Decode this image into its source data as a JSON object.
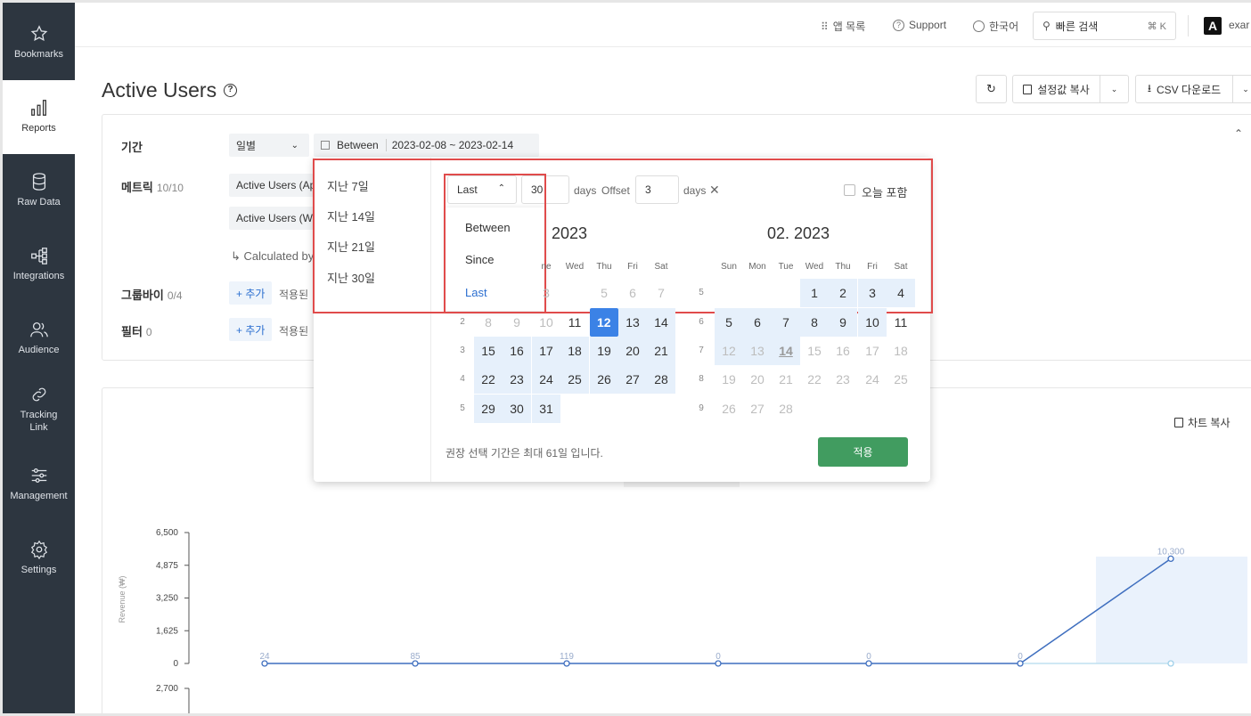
{
  "sidebar": {
    "items": [
      {
        "label": "Bookmarks",
        "icon": "star-icon"
      },
      {
        "label": "Reports",
        "icon": "bar-chart-icon"
      },
      {
        "label": "Raw Data",
        "icon": "database-icon"
      },
      {
        "label": "Integrations",
        "icon": "integrations-icon"
      },
      {
        "label": "Audience",
        "icon": "audience-icon"
      },
      {
        "label": "Tracking\nLink",
        "icon": "link-icon"
      },
      {
        "label": "Management",
        "icon": "sliders-icon"
      },
      {
        "label": "Settings",
        "icon": "gear-icon"
      }
    ]
  },
  "topbar": {
    "apps": "앱 목록",
    "support": "Support",
    "language": "한국어",
    "search_placeholder": "빠른 검색",
    "search_shortcut": "⌘ K",
    "user_initial": "A",
    "user_name": "exar"
  },
  "header": {
    "title": "Active Users",
    "copy_settings": "설정값 복사",
    "csv_download": "CSV 다운로드"
  },
  "filters": {
    "period_label": "기간",
    "granularity": "일별",
    "date_mode": "Between",
    "date_range": "2023-02-08 ~ 2023-02-14",
    "metric_label": "메트릭",
    "metric_count": "10/10",
    "metric_1": "Active Users (Ap",
    "metric_2": "Active Users (W",
    "calculated": "Calculated by",
    "groupby_label": "그룹바이",
    "groupby_count": "0/4",
    "groupby_add": "+ 추가",
    "groupby_applied": "적용된",
    "filter_label": "필터",
    "filter_count": "0",
    "filter_add": "+ 추가",
    "filter_applied": "적용된"
  },
  "datepicker": {
    "quick": [
      "지난 7일",
      "지난 14일",
      "지난 21일",
      "지난 30일"
    ],
    "mode": "Last",
    "days_value": "30",
    "days_label": "days",
    "offset_label": "Offset",
    "offset_value": "3",
    "offset_days_label": "days",
    "include_today": "오늘 포함",
    "mode_options": [
      "Between",
      "Since",
      "Last"
    ],
    "month1_title": ". 2023",
    "month2_title": "02. 2023",
    "weekdays_left": [
      "ne",
      "Wed",
      "Thu",
      "Fri",
      "Sat"
    ],
    "weekdays_right": [
      "Sun",
      "Mon",
      "Tue",
      "Wed",
      "Thu",
      "Fri",
      "Sat"
    ],
    "note": "권장 선택 기간은 최대 61일 입니다.",
    "apply": "적용"
  },
  "chart": {
    "copy_label": "차트 복사"
  },
  "chart_data": {
    "type": "line",
    "ylabel": "Revenue (₩)",
    "yticks": [
      "6,500",
      "4,875",
      "3,250",
      "1,625",
      "0"
    ],
    "ylim": [
      0,
      6500
    ],
    "series": [
      {
        "values": [
          0,
          0,
          0,
          0,
          0,
          0,
          5200
        ],
        "labels": [
          "24",
          "85",
          "119",
          "0",
          "0",
          "0",
          "10,300"
        ]
      }
    ],
    "second_axis_top": "2,700"
  }
}
